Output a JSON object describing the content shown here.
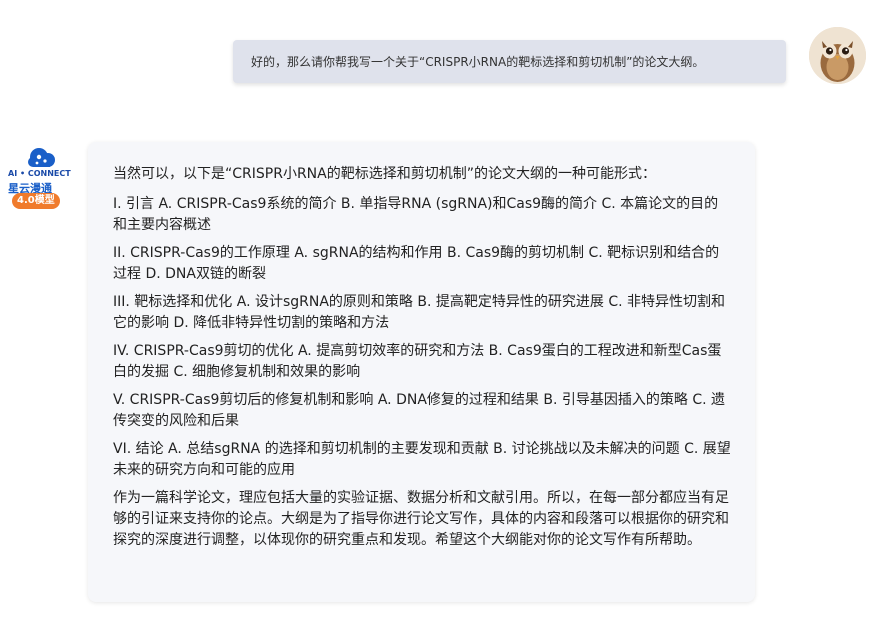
{
  "user_message": {
    "text": "好的，那么请你帮我写一个关于“CRISPR小RNA的靶标选择和剪切机制”的论文大纲。"
  },
  "bot": {
    "logo_text_top": "AI • CONNECT",
    "logo_text_brand": "星云漫通",
    "model_badge": "4.0模型",
    "intro": "当然可以，以下是“CRISPR小RNA的靶标选择和剪切机制”的论文大纲的一种可能形式：",
    "sections": [
      "I. 引言 A. CRISPR-Cas9系统的简介 B. 单指导RNA (sgRNA)和Cas9酶的简介 C. 本篇论文的目的和主要内容概述",
      "II. CRISPR-Cas9的工作原理 A. sgRNA的结构和作用 B. Cas9酶的剪切机制 C. 靶标识别和结合的过程 D. DNA双链的断裂",
      "III. 靶标选择和优化 A. 设计sgRNA的原则和策略 B. 提高靶定特异性的研究进展 C. 非特异性切割和它的影响 D. 降低非特异性切割的策略和方法",
      "IV. CRISPR-Cas9剪切的优化 A. 提高剪切效率的研究和方法 B. Cas9蛋白的工程改进和新型Cas蛋白的发掘 C. 细胞修复机制和效果的影响",
      "V. CRISPR-Cas9剪切后的修复机制和影响 A. DNA修复的过程和结果 B. 引导基因插入的策略 C. 遗传突变的风险和后果",
      "VI. 结论 A. 总结sgRNA 的选择和剪切机制的主要发现和贡献 B. 讨论挑战以及未解决的问题 C. 展望未来的研究方向和可能的应用"
    ],
    "closing": "作为一篇科学论文，理应包括大量的实验证据、数据分析和文献引用。所以，在每一部分都应当有足够的引证来支持你的论点。大纲是为了指导你进行论文写作，具体的内容和段落可以根据你的研究和探究的深度进行调整，以体现你的研究重点和发现。希望这个大纲能对你的论文写作有所帮助。"
  }
}
